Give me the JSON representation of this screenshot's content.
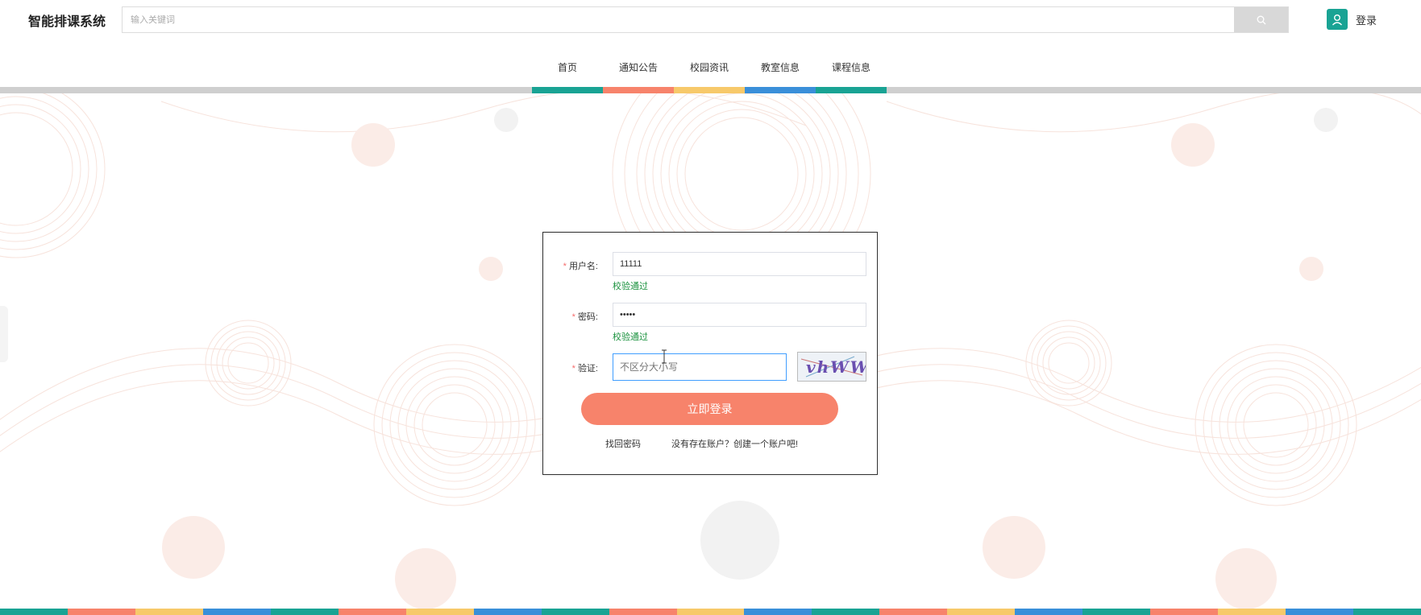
{
  "header": {
    "brand": "智能排课系统",
    "search_placeholder": "输入关键词",
    "login_label": "登录"
  },
  "nav": {
    "items": [
      {
        "label": "首页",
        "color": "#19a394"
      },
      {
        "label": "通知公告",
        "color": "#f7836b"
      },
      {
        "label": "校园资讯",
        "color": "#f7c96a"
      },
      {
        "label": "教室信息",
        "color": "#3a8fd9"
      },
      {
        "label": "课程信息",
        "color": "#19a394"
      }
    ]
  },
  "login_form": {
    "username": {
      "label": "用户名:",
      "value": "11111",
      "validation": "校验通过"
    },
    "password": {
      "label": "密码:",
      "value": "•••••",
      "validation": "校验通过"
    },
    "captcha": {
      "label": "验证:",
      "placeholder": "不区分大小写",
      "image_text": "vhWW"
    },
    "submit_label": "立即登录",
    "forgot_password": "找回密码",
    "register_link": "没有存在账户？创建一个账户吧!"
  },
  "colors": {
    "teal": "#19a394",
    "coral": "#f7836b",
    "yellow": "#f7c96a",
    "blue": "#3a8fd9",
    "required": "#f56c6c",
    "success": "#19913d"
  },
  "icons": {
    "search": "search-icon",
    "user": "user-icon"
  }
}
